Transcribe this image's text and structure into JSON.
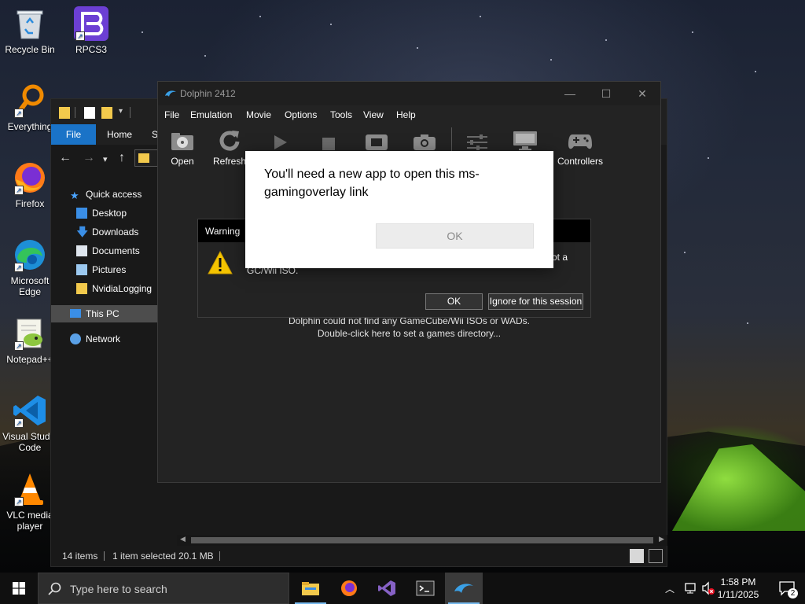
{
  "desktop": {
    "icons": [
      {
        "label": "Recycle Bin"
      },
      {
        "label": "RPCS3"
      },
      {
        "label": "Everything"
      },
      {
        "label": "Firefox"
      },
      {
        "label": "Microsoft Edge"
      },
      {
        "label": "Notepad++"
      },
      {
        "label": "Visual Studio Code"
      },
      {
        "label": "VLC media player"
      }
    ]
  },
  "explorer": {
    "ribbon_tabs": [
      "File",
      "Home",
      "S"
    ],
    "nav": {
      "quick_access": "Quick access",
      "items": [
        "Desktop",
        "Downloads",
        "Documents",
        "Pictures",
        "NvidiaLogging"
      ],
      "this_pc": "This PC",
      "network": "Network"
    },
    "status": {
      "items": "14 items",
      "selected": "1 item selected",
      "size": "20.1 MB"
    }
  },
  "dolphin": {
    "title": "Dolphin 2412",
    "menu": [
      "File",
      "Emulation",
      "Movie",
      "Options",
      "Tools",
      "View",
      "Help"
    ],
    "toolbar": {
      "open": "Open",
      "refresh": "Refresh",
      "controllers": "Controllers"
    },
    "games_msg_line1": "Dolphin could not find any GameCube/Wii ISOs or WADs.",
    "games_msg_line2": "Double-click here to set a games directory..."
  },
  "warning": {
    "title": "Warning",
    "text_right": "ot a",
    "text_line2": "GC/Wii ISO.",
    "ok": "OK",
    "ignore": "Ignore for this session"
  },
  "popup": {
    "message": "You'll need a new app to open this ms-gamingoverlay link",
    "ok": "OK"
  },
  "taskbar": {
    "search_placeholder": "Type here to search",
    "time": "1:58 PM",
    "date": "1/11/2025",
    "notification_count": "2"
  },
  "colors": {
    "accent": "#1a73c7",
    "taskbar": "#101010",
    "dolphin_bg": "#232323",
    "warning_icon": "#f5c400"
  }
}
